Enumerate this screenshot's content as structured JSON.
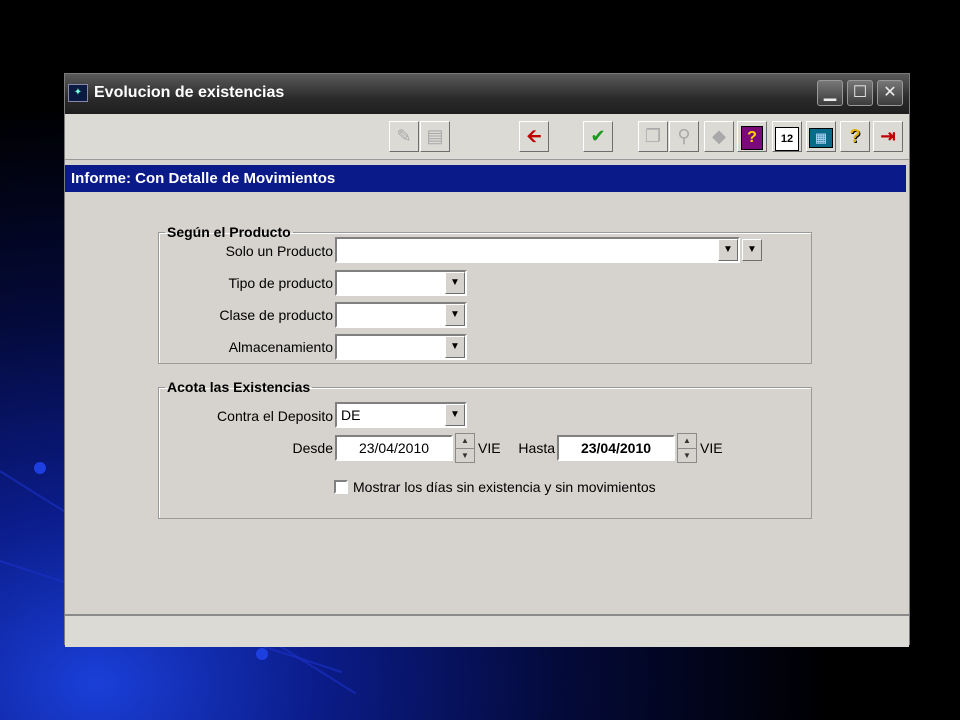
{
  "window": {
    "title": "Evolucion de existencias",
    "controls": {
      "minimize": "▁",
      "maximize": "☐",
      "close": "✕"
    }
  },
  "toolbar": {
    "buttons": [
      {
        "name": "edit-doc-button",
        "glyph": "✎",
        "enabled": false
      },
      {
        "name": "print-button",
        "glyph": "▤",
        "enabled": false
      },
      {
        "name": "back-button",
        "glyph": "🡨",
        "enabled": true
      },
      {
        "name": "accept-button",
        "glyph": "✔",
        "enabled": true
      },
      {
        "name": "copy-button",
        "glyph": "❐",
        "enabled": false
      },
      {
        "name": "find-button",
        "glyph": "⚲",
        "enabled": false
      },
      {
        "name": "tag-button",
        "glyph": "◆",
        "enabled": false
      },
      {
        "name": "query-button",
        "glyph": "?",
        "enabled": true
      },
      {
        "name": "numbers-button",
        "glyph": "12",
        "enabled": true
      },
      {
        "name": "calculator-button",
        "glyph": "▦",
        "enabled": true
      },
      {
        "name": "help-button",
        "glyph": "?",
        "enabled": true
      },
      {
        "name": "exit-button",
        "glyph": "⇥",
        "enabled": true
      }
    ]
  },
  "header": {
    "title": "Informe: Con Detalle de Movimientos"
  },
  "producto": {
    "legend": "Según el Producto",
    "solo_label": "Solo un Producto",
    "solo_value": "",
    "tipo_label": "Tipo de producto",
    "tipo_value": "",
    "clase_label": "Clase de producto",
    "clase_value": "",
    "almacen_label": "Almacenamiento",
    "almacen_value": ""
  },
  "existencias": {
    "legend": "Acota las Existencias",
    "deposito_label": "Contra el  Deposito",
    "deposito_value": "DE",
    "desde_label": "Desde",
    "desde_value": "23/04/2010",
    "desde_day": "VIE",
    "hasta_label": "Hasta",
    "hasta_value": "23/04/2010",
    "hasta_day": "VIE",
    "mostrar_label": "Mostrar los días sin existencia y sin movimientos",
    "mostrar_checked": false
  },
  "colors": {
    "header_band": "#0a1a88",
    "back_arrow": "#c00000",
    "accept_check": "#1a9a1a"
  }
}
